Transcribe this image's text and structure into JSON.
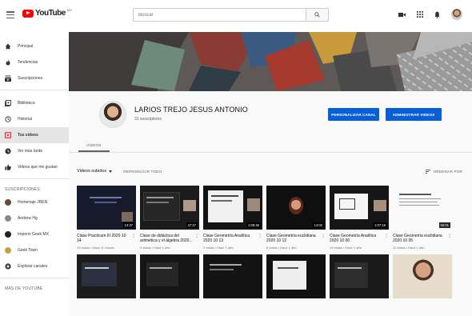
{
  "topbar": {
    "logo_text": "YouTube",
    "logo_region": "MX",
    "search_placeholder": "Buscar"
  },
  "sidebar": {
    "items": [
      {
        "label": "Principal",
        "icon": "home-icon"
      },
      {
        "label": "Tendencias",
        "icon": "fire-icon"
      },
      {
        "label": "Suscripciones",
        "icon": "subscriptions-icon"
      }
    ],
    "library_items": [
      {
        "label": "Biblioteca",
        "icon": "library-icon"
      },
      {
        "label": "Historial",
        "icon": "history-icon"
      },
      {
        "label": "Tus videos",
        "icon": "your-videos-icon",
        "active": true
      },
      {
        "label": "Ver más tarde",
        "icon": "clock-icon"
      },
      {
        "label": "Videos que me gustan",
        "icon": "thumbs-up-icon"
      }
    ],
    "subs_heading": "SUSCRIPCIONES",
    "subs": [
      {
        "label": "Homenaje JREN",
        "color": "#6b4a33"
      },
      {
        "label": "Andrew Hg",
        "color": "#8a8a8a"
      },
      {
        "label": "Imperio Geek MX",
        "color": "#222222"
      },
      {
        "label": "Geek Town",
        "color": "#c8a04a"
      },
      {
        "label": "Explorar canales",
        "color": "#333333"
      }
    ],
    "more_heading": "MÁS DE YOUTUBE"
  },
  "channel": {
    "name": "LARIOS TREJO JESUS ANTONIO",
    "subscribers": "31 suscriptores",
    "customize_label": "PERSONALIZAR CANAL",
    "manage_label": "ADMINISTRAR VIDEOS",
    "tab_videos": "VIDEOS"
  },
  "filters": {
    "uploads_label": "Videos subidos",
    "play_all_label": "REPRODUCIR TODO",
    "sort_label": "ORDENAR POR"
  },
  "videos_row1": [
    {
      "title": "Clase Practicum III 2020 10 14",
      "meta": "19 vistas • Hace 11 meses",
      "duration": "13:37"
    },
    {
      "title": "Clase de didáctica del aritmética y el álgebra 2020...",
      "meta": "3 vistas • Hace 1 año",
      "duration": "47:27"
    },
    {
      "title": "Clase Geometría Analítica 2020 10 13",
      "meta": "2 vistas • Hace 1 año",
      "duration": "1:08:46"
    },
    {
      "title": "Clase Geometría euclidiana 2020 10 12",
      "meta": "8 vistas • Hace 1 año",
      "duration": "14:02"
    },
    {
      "title": "Clase Geometría Analítica 2020 10 06",
      "meta": "19 vistas • Hace 1 año",
      "duration": "1:07:19"
    },
    {
      "title": "Clase Geometría euclidiana 2020 10 05",
      "meta": "11 vistas • Hace 1 año",
      "duration": "50:01"
    }
  ]
}
